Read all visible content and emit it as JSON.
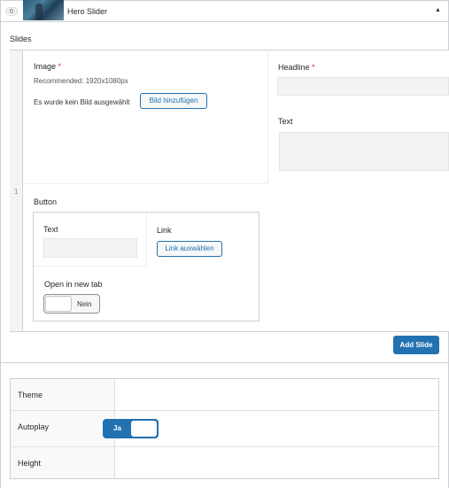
{
  "layout": {
    "index": "0",
    "title": "Hero Slider",
    "collapse_glyph": "▲"
  },
  "slides": {
    "label": "Slides",
    "row_number": "1",
    "image": {
      "label": "Image",
      "required": "*",
      "recommended": "Recommended: 1920x1080px",
      "empty_text": "Es wurde kein Bild ausgewählt",
      "add_button": "Bild hinzufügen"
    },
    "headline": {
      "label": "Headline",
      "required": "*",
      "value": ""
    },
    "text": {
      "label": "Text",
      "value": ""
    },
    "button": {
      "label": "Button",
      "text_label": "Text",
      "text_value": "",
      "link_label": "Link",
      "link_button": "Link auswählen",
      "new_tab_label": "Open in new tab",
      "new_tab_state": "Nein"
    },
    "add_slide_button": "Add Slide"
  },
  "settings": {
    "theme_label": "Theme",
    "autoplay_label": "Autoplay",
    "autoplay_state": "Ja",
    "height_label": "Height"
  },
  "colors": {
    "accent": "#2271b1",
    "required": "#dc3232",
    "border": "#ccd0d4"
  }
}
